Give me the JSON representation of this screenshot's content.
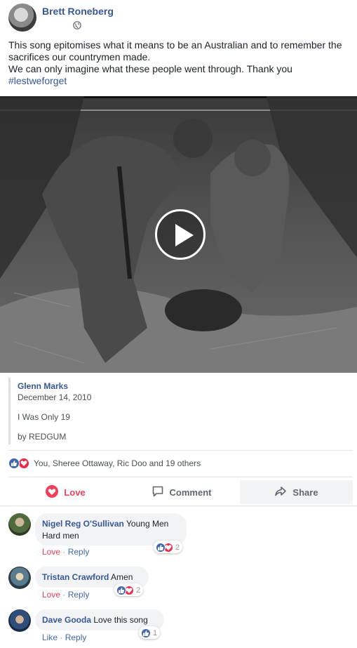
{
  "post": {
    "author": "Brett Roneberg",
    "privacy_icon": "globe-icon",
    "text_line1": "This song epitomises what it means to be an Australian and to remember the sacrifices our countrymen made.",
    "text_line2": "We can only imagine what these people went through. Thank you",
    "hashtag": "#lestweforget"
  },
  "video": {
    "play_icon": "play-icon"
  },
  "card": {
    "author": "Glenn Marks",
    "date": "December 14, 2010",
    "title": "I Was Only 19",
    "by": "by REDGUM"
  },
  "reactions": {
    "summary": "You, Sheree Ottaway, Ric Doo and 19 others",
    "icons": [
      "like-icon",
      "love-icon"
    ]
  },
  "actions": {
    "love": "Love",
    "comment": "Comment",
    "share": "Share"
  },
  "comments": [
    {
      "name": "Nigel Reg O'Sullivan",
      "text_a": "Young Men",
      "text_b": "Hard men",
      "reaction": "Love",
      "reply": "Reply",
      "count": "2"
    },
    {
      "name": "Tristan Crawford",
      "text_a": "Amen",
      "reaction": "Love",
      "reply": "Reply",
      "count": "2"
    },
    {
      "name": "Dave Gooda",
      "text_a": "Love this song",
      "reaction": "Like",
      "reply": "Reply",
      "count": "1"
    }
  ],
  "colors": {
    "link_blue": "#365899",
    "love_red": "#f33e58",
    "like_blue": "#4267b2"
  }
}
